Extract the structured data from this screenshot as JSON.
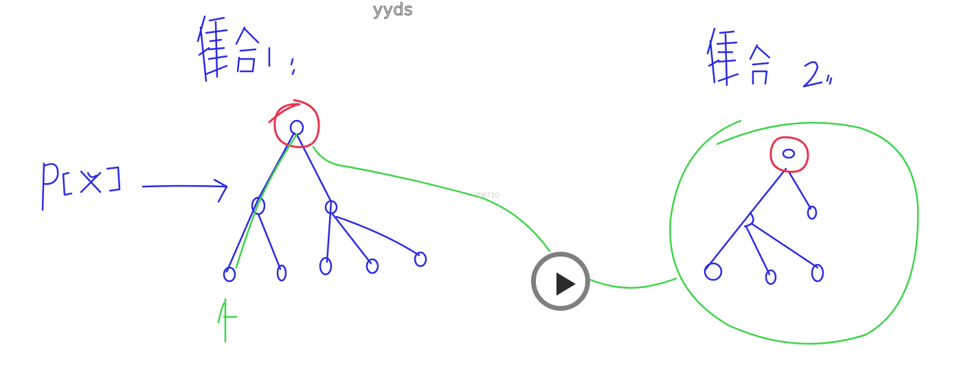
{
  "header": {
    "title": "yyds"
  },
  "watermark": {
    "text": "206710"
  },
  "player": {
    "play_icon": "play-icon"
  },
  "colors": {
    "ink_blue": "#2a2ae6",
    "ink_red": "#e8344f",
    "ink_green": "#3fd44a",
    "control_gray": "#7f7f7f"
  }
}
